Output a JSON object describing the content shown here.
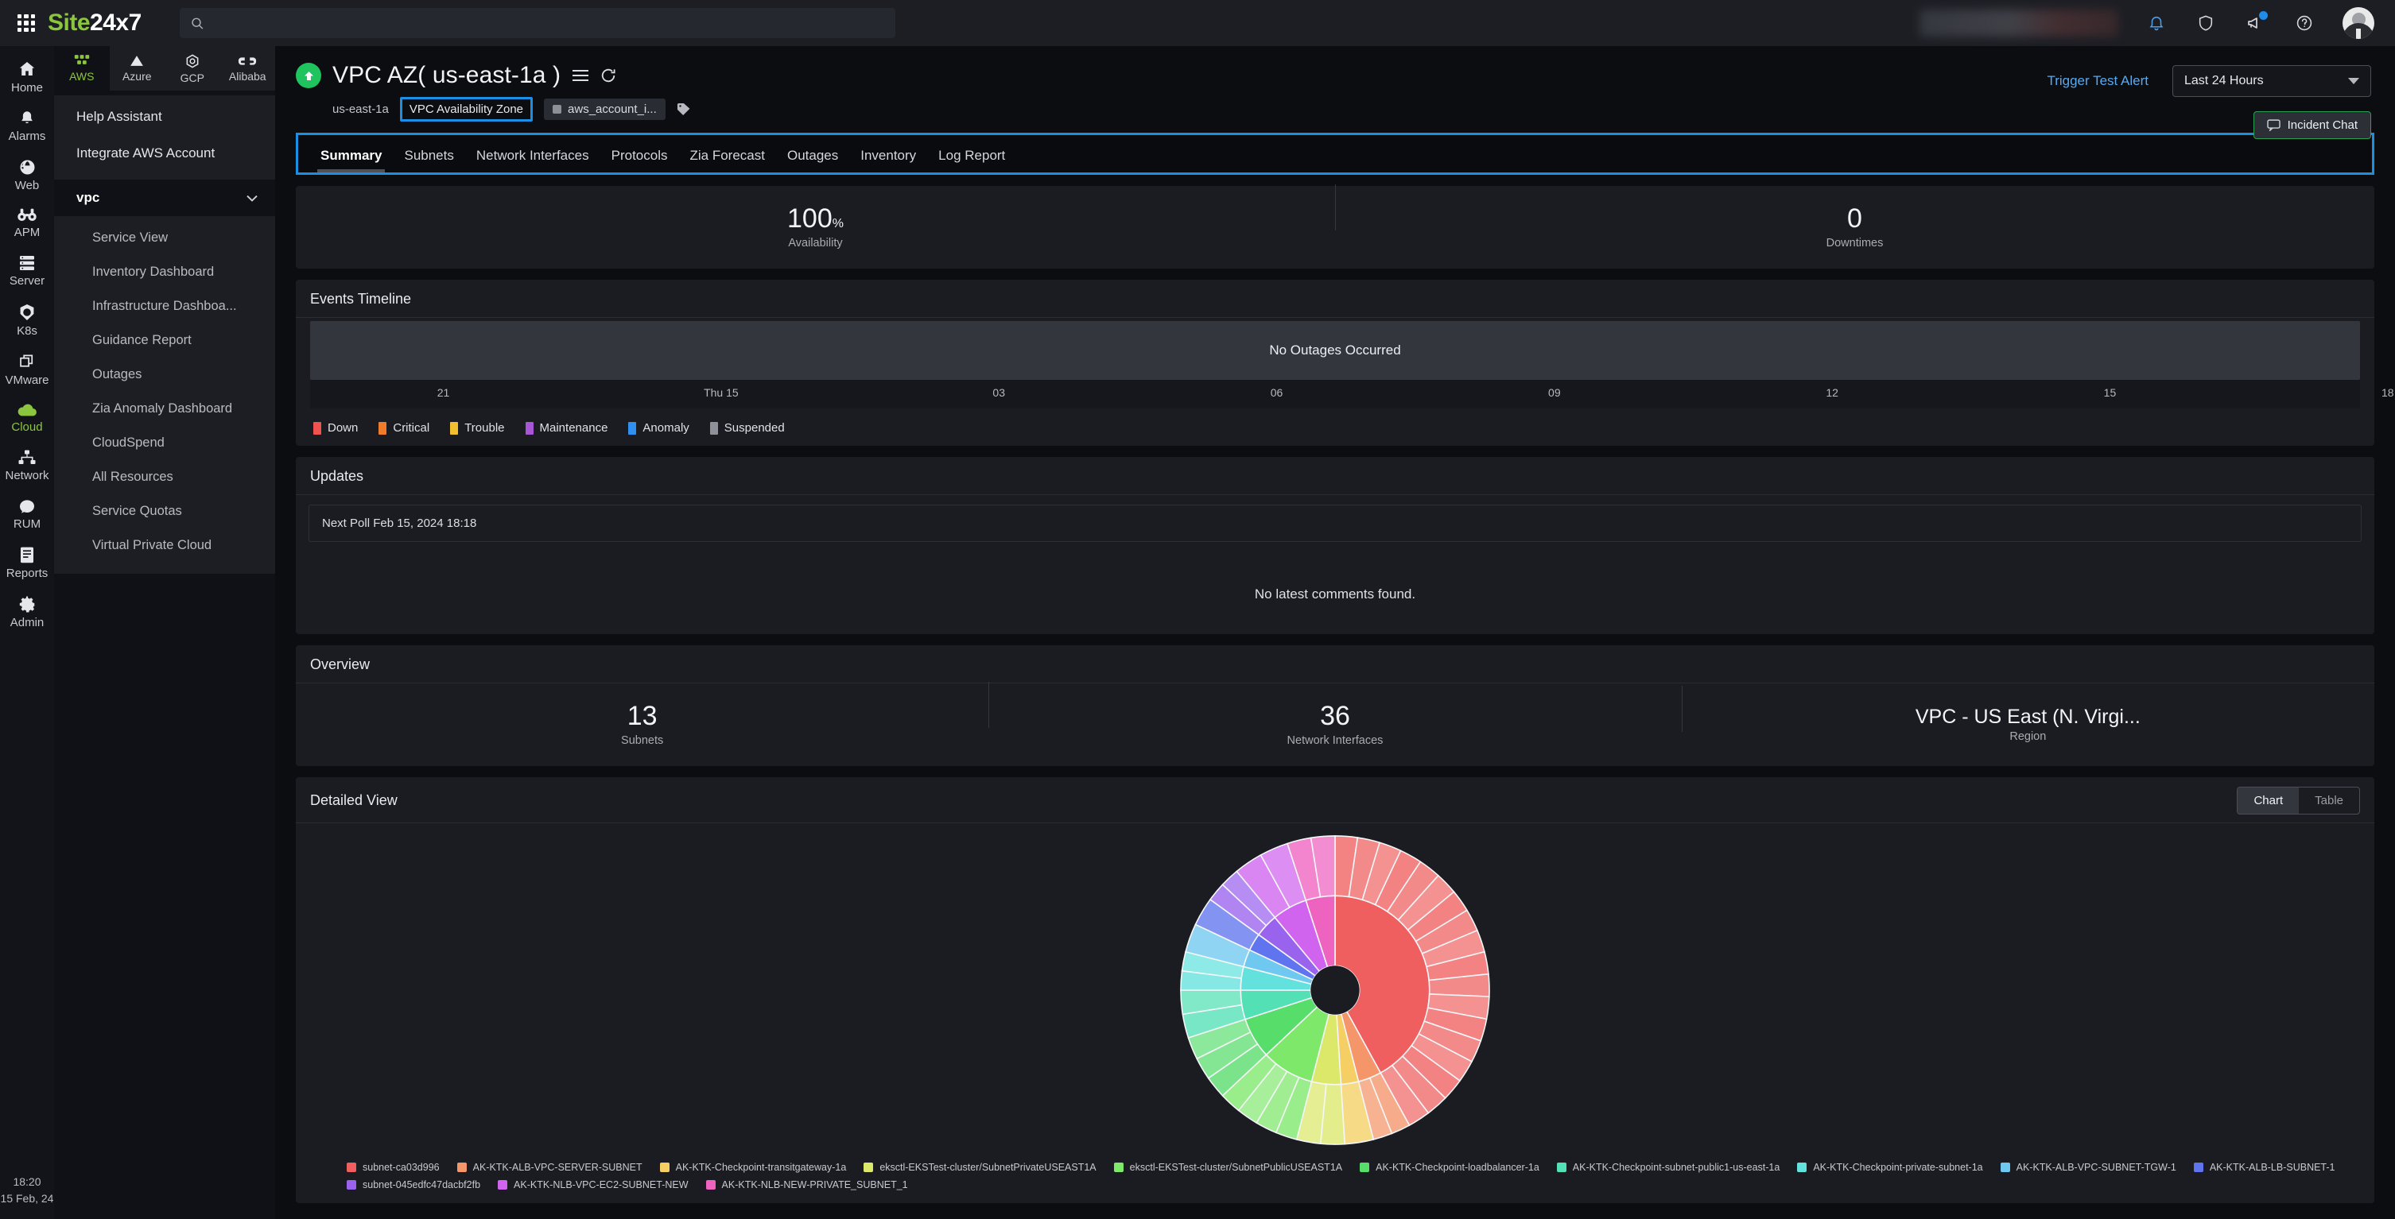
{
  "topbar": {
    "brand_green": "Site",
    "brand_white": "24x7",
    "search_placeholder": "",
    "search_value": "",
    "icons": [
      "waffle-icon",
      "search-icon",
      "bell-icon",
      "shield-icon",
      "announcement-icon",
      "help-icon",
      "avatar"
    ]
  },
  "rail": {
    "items": [
      {
        "label": "Home",
        "icon": "home-icon",
        "active": false
      },
      {
        "label": "Alarms",
        "icon": "bell-icon",
        "active": false
      },
      {
        "label": "Web",
        "icon": "globe-icon",
        "active": false
      },
      {
        "label": "APM",
        "icon": "binoculars-icon",
        "active": false
      },
      {
        "label": "Server",
        "icon": "server-icon",
        "active": false
      },
      {
        "label": "K8s",
        "icon": "kubernetes-icon",
        "active": false
      },
      {
        "label": "VMware",
        "icon": "vmware-icon",
        "active": false
      },
      {
        "label": "Cloud",
        "icon": "cloud-icon",
        "active": true
      },
      {
        "label": "Network",
        "icon": "network-icon",
        "active": false
      },
      {
        "label": "RUM",
        "icon": "rum-icon",
        "active": false
      },
      {
        "label": "Reports",
        "icon": "reports-icon",
        "active": false
      },
      {
        "label": "Admin",
        "icon": "gear-icon",
        "active": false
      }
    ],
    "clock_time": "18:20",
    "clock_date": "15 Feb, 24"
  },
  "providers": [
    {
      "label": "AWS",
      "icon": "aws-icon",
      "active": true
    },
    {
      "label": "Azure",
      "icon": "azure-icon",
      "active": false
    },
    {
      "label": "GCP",
      "icon": "gcp-icon",
      "active": false
    },
    {
      "label": "Alibaba",
      "icon": "alibaba-icon",
      "active": false
    }
  ],
  "menu": {
    "top_items": [
      "Help Assistant",
      "Integrate AWS Account"
    ],
    "group_label": "vpc",
    "sub_items": [
      "Service View",
      "Inventory Dashboard",
      "Infrastructure Dashboa...",
      "Guidance Report",
      "Outages",
      "Zia Anomaly Dashboard",
      "CloudSpend",
      "All Resources",
      "Service Quotas",
      "Virtual Private Cloud"
    ]
  },
  "header": {
    "title": "VPC AZ( us-east-1a )",
    "status": "up",
    "meta_zone": "us-east-1a",
    "meta_type": "VPC Availability Zone",
    "meta_tag": "aws_account_i...",
    "trigger_label": "Trigger Test Alert",
    "period_value": "Last 24 Hours",
    "incident_chat_label": "Incident Chat"
  },
  "tabs": [
    {
      "label": "Summary",
      "active": true
    },
    {
      "label": "Subnets",
      "active": false
    },
    {
      "label": "Network Interfaces",
      "active": false
    },
    {
      "label": "Protocols",
      "active": false
    },
    {
      "label": "Zia Forecast",
      "active": false
    },
    {
      "label": "Outages",
      "active": false
    },
    {
      "label": "Inventory",
      "active": false
    },
    {
      "label": "Log Report",
      "active": false
    }
  ],
  "stats": {
    "availability_value": "100",
    "availability_unit": "%",
    "availability_label": "Availability",
    "downtimes_value": "0",
    "downtimes_label": "Downtimes"
  },
  "events_timeline": {
    "title": "Events Timeline",
    "band_text": "No Outages Occurred",
    "axis_ticks": [
      "21",
      "Thu 15",
      "03",
      "06",
      "09",
      "12",
      "15",
      "18"
    ],
    "legend": [
      {
        "label": "Down",
        "color": "#ef5350"
      },
      {
        "label": "Critical",
        "color": "#f07c2b"
      },
      {
        "label": "Trouble",
        "color": "#f2c02e"
      },
      {
        "label": "Maintenance",
        "color": "#a855d6"
      },
      {
        "label": "Anomaly",
        "color": "#2f90f0"
      },
      {
        "label": "Suspended",
        "color": "#8e9199"
      }
    ]
  },
  "updates": {
    "title": "Updates",
    "next_poll": "Next Poll Feb 15, 2024 18:18",
    "empty_text": "No latest comments found."
  },
  "overview": {
    "title": "Overview",
    "items": [
      {
        "value": "13",
        "label": "Subnets"
      },
      {
        "value": "36",
        "label": "Network Interfaces"
      },
      {
        "value": "VPC - US East (N. Virgi...",
        "label": "Region"
      }
    ]
  },
  "detailed_view": {
    "title": "Detailed View",
    "toggle": [
      {
        "label": "Chart",
        "active": true
      },
      {
        "label": "Table",
        "active": false
      }
    ]
  },
  "chart_data": {
    "type": "pie",
    "subtype": "sunburst",
    "title": "Detailed View",
    "inner_radius_ratio": 0.155,
    "mid_radius_ratio": 0.6,
    "outer_radius_ratio": 0.98,
    "start_angle_deg": -90,
    "legend_position": "bottom",
    "categories": [
      "subnet-ca03d996",
      "AK-KTK-ALB-VPC-SERVER-SUBNET",
      "AK-KTK-Checkpoint-transitgateway-1a",
      "eksctl-EKSTest-cluster/SubnetPrivateUSEAST1A",
      "eksctl-EKSTest-cluster/SubnetPublicUSEAST1A",
      "AK-KTK-Checkpoint-loadbalancer-1a",
      "AK-KTK-Checkpoint-subnet-public1-us-east-1a",
      "AK-KTK-Checkpoint-private-subnet-1a",
      "AK-KTK-ALB-VPC-SUBNET-TGW-1",
      "AK-KTK-ALB-LB-SUBNET-1",
      "subnet-045edfc47dacbf2fb",
      "AK-KTK-NLB-VPC-EC2-SUBNET-NEW",
      "AK-KTK-NLB-NEW-PRIVATE_SUBNET_1"
    ],
    "colors": [
      "#ef5f5f",
      "#f4956a",
      "#f5cf63",
      "#dbe86a",
      "#7ee86a",
      "#56dd6a",
      "#52e0b4",
      "#63e2dd",
      "#6fc8f0",
      "#5f74ee",
      "#9a63ee",
      "#d064ee",
      "#ee63c0"
    ],
    "values": [
      42,
      4,
      3,
      5,
      9,
      7,
      5,
      4,
      3,
      3,
      4,
      6,
      5
    ],
    "outer_counts": [
      18,
      2,
      1,
      2,
      4,
      3,
      2,
      2,
      1,
      1,
      2,
      2,
      2
    ],
    "xlabel": "",
    "ylabel": ""
  }
}
